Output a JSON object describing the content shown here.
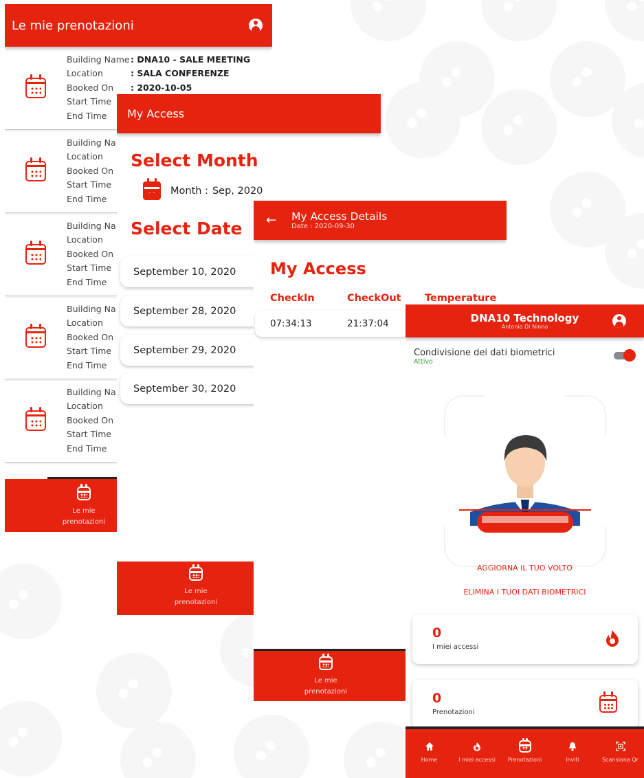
{
  "theme": {
    "primary": "#e6230f",
    "text": "#333333",
    "active_green": "#3aa53a"
  },
  "screen_bookings": {
    "title": "Le mie prenotazioni",
    "account_icon": "account-circle-icon",
    "items": [
      {
        "building_label": "Building Name",
        "building_value": ": DNA10 - SALE MEETING",
        "location_label": "Location",
        "location_value": ": SALA CONFERENZE",
        "booked_label": "Booked On",
        "booked_value": ": 2020-10-05",
        "start_label": "Start Time",
        "end_label": "End Time"
      },
      {
        "building_label": "Building Na",
        "location_label": "Location",
        "booked_label": "Booked On",
        "start_label": "Start Time",
        "end_label": "End Time"
      },
      {
        "building_label": "Building Na",
        "location_label": "Location",
        "booked_label": "Booked On",
        "start_label": "Start Time",
        "end_label": "End Time"
      },
      {
        "building_label": "Building Na",
        "location_label": "Location",
        "booked_label": "Booked On",
        "start_label": "Start Time",
        "end_label": "End Time"
      },
      {
        "building_label": "Building Na",
        "location_label": "Location",
        "booked_label": "Booked On",
        "start_label": "Start Time",
        "end_label": "End Time"
      }
    ],
    "bottom_tab_line1": "Le mie",
    "bottom_tab_line2": "prenotazioni"
  },
  "screen_access": {
    "title": "My Access",
    "select_month": "Select Month",
    "month_label": "Month :",
    "month_value": "Sep, 2020",
    "select_date": "Select Date",
    "dates": [
      "September 10, 2020",
      "September 28, 2020",
      "September 29, 2020",
      "September 30, 2020"
    ],
    "bottom_tab_line1": "Le mie",
    "bottom_tab_line2": "prenotazioni"
  },
  "screen_access_details": {
    "title": "My Access Details",
    "subtitle": "Date : 2020-09-30",
    "heading": "My Access",
    "columns": [
      "CheckIn",
      "CheckOut",
      "Temperature"
    ],
    "rows": [
      {
        "checkin": "07:34:13",
        "checkout": "21:37:04"
      }
    ],
    "bottom_tab_line1": "Le mie",
    "bottom_tab_line2": "prenotazioni"
  },
  "screen_home": {
    "brand_title": "DNA10 Technology",
    "brand_sub": "Antonio Di Ninno",
    "biometric_label": "Condivisione dei dati biometrici",
    "biometric_status": "Attivo",
    "update_face": "AGGIORNA IL TUO VOLTO",
    "delete_bio": "ELIMINA I TUOI DATI BIOMETRICI",
    "stats": [
      {
        "value": "0",
        "label": "I miei accessi",
        "icon": "flame-icon"
      },
      {
        "value": "0",
        "label": "Prenotazioni",
        "icon": "calendar-icon"
      }
    ],
    "nav": [
      {
        "label": "Home",
        "icon": "home-icon"
      },
      {
        "label": "I miei accessi",
        "icon": "flame-icon"
      },
      {
        "label": "Prenotazioni",
        "icon": "calendar-icon"
      },
      {
        "label": "Inviti",
        "icon": "bell-icon"
      },
      {
        "label": "Scansiona Qr",
        "icon": "qr-scan-icon"
      }
    ]
  }
}
